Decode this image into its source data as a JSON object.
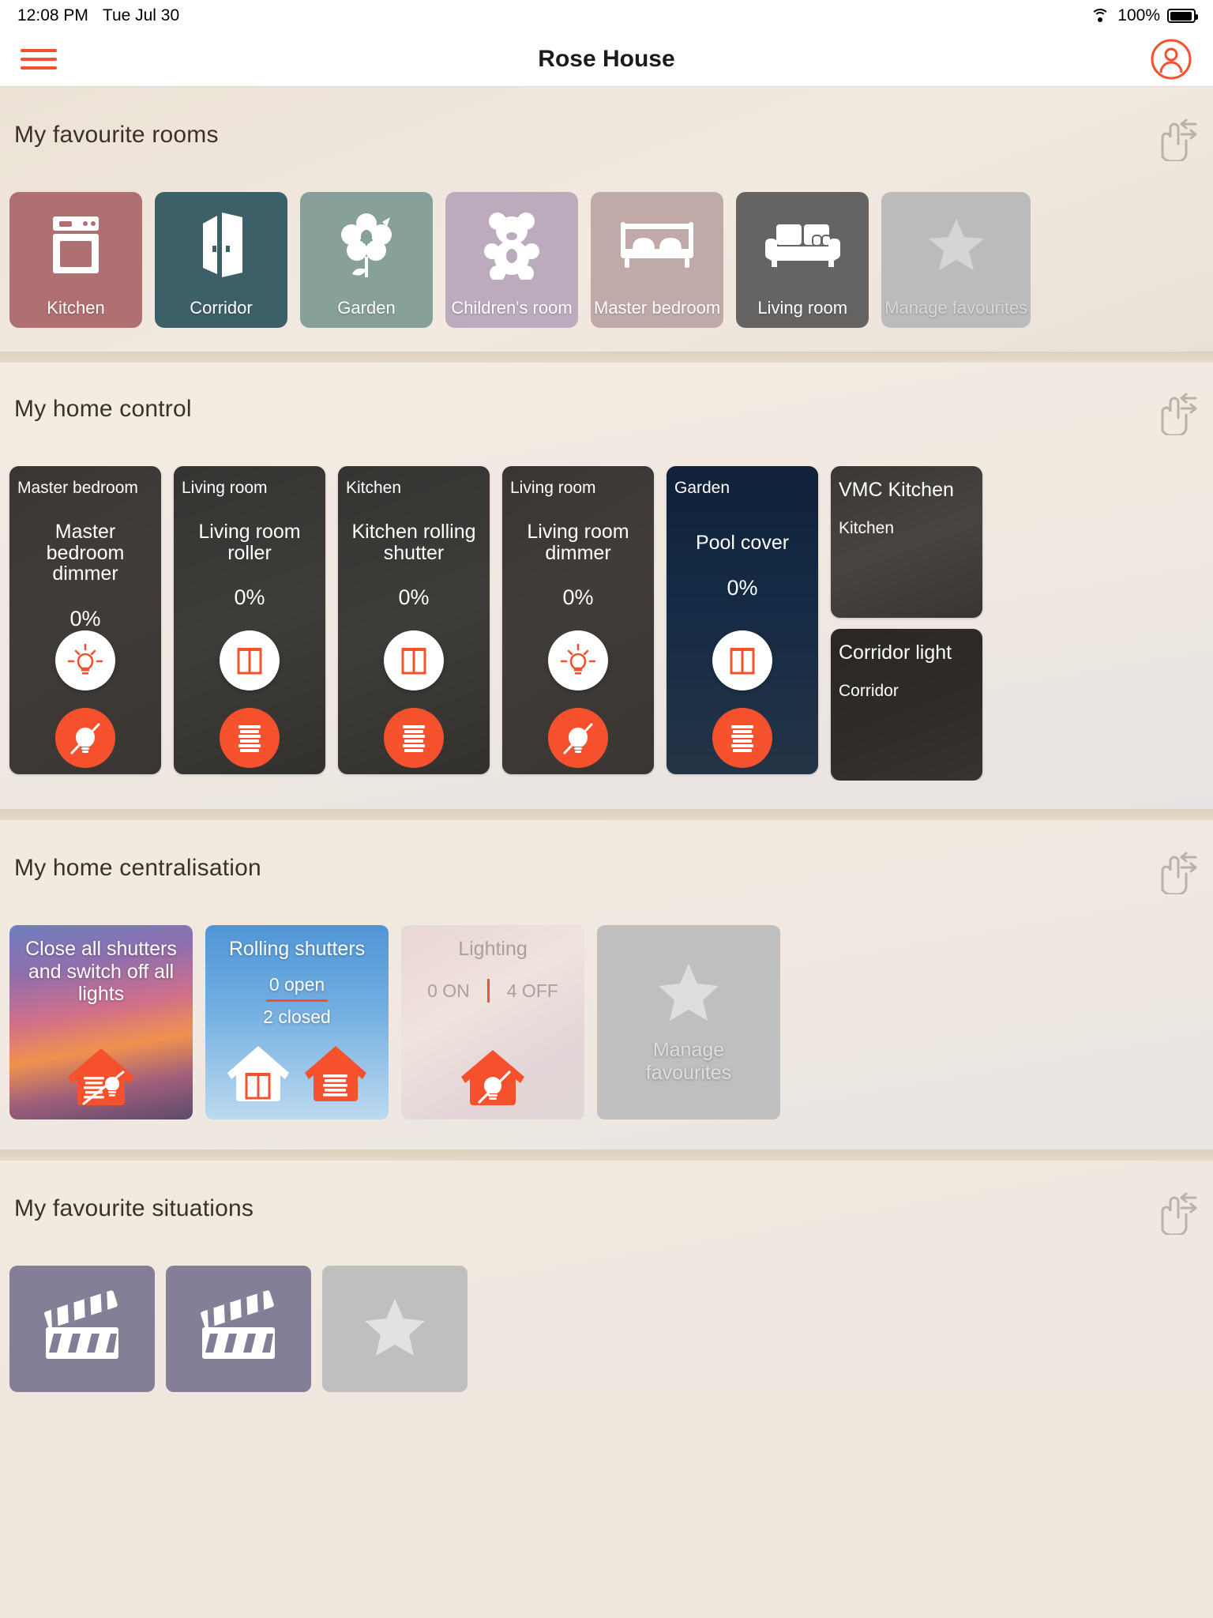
{
  "statusbar": {
    "time": "12:08 PM",
    "date": "Tue Jul 30",
    "battery_percent": "100%",
    "wifi_icon": "wifi-icon",
    "battery_icon": "battery-full-icon"
  },
  "header": {
    "title": "Rose House",
    "menu_icon": "hamburger-menu-icon",
    "account_icon": "account-circle-icon"
  },
  "colors": {
    "accent": "#f4512c",
    "page_background": "#efe7de",
    "section_title": "#3b3129"
  },
  "sections": {
    "rooms": {
      "title": "My favourite rooms",
      "swipe_hint_icon": "swipe-hand-icon",
      "items": [
        {
          "label": "Kitchen",
          "icon": "oven-icon",
          "color": "#b06f70"
        },
        {
          "label": "Corridor",
          "icon": "door-open-icon",
          "color": "#3d5f68"
        },
        {
          "label": "Garden",
          "icon": "flower-icon",
          "color": "#87a09a"
        },
        {
          "label": "Children's room",
          "icon": "teddy-bear-icon",
          "color": "#bbabbd"
        },
        {
          "label": "Master bedroom",
          "icon": "bed-icon",
          "color": "#bfaaa8"
        },
        {
          "label": "Living room",
          "icon": "sofa-icon",
          "color": "#656463"
        },
        {
          "label": "Manage favourites",
          "icon": "star-icon",
          "color": "#bbbbbb"
        }
      ]
    },
    "control": {
      "title": "My home control",
      "swipe_hint_icon": "swipe-hand-icon",
      "items": [
        {
          "room": "Master bedroom",
          "name": "Master bedroom dimmer",
          "value": "0%",
          "primary_icon": "lightbulb-icon",
          "secondary_icon": "lightbulb-off-icon",
          "bg": "grad-bedroom"
        },
        {
          "room": "Living room",
          "name": "Living room roller",
          "value": "0%",
          "primary_icon": "shutter-open-icon",
          "secondary_icon": "shutter-closed-icon",
          "bg": "grad-blinds"
        },
        {
          "room": "Kitchen",
          "name": "Kitchen rolling shutter",
          "value": "0%",
          "primary_icon": "shutter-open-icon",
          "secondary_icon": "shutter-closed-icon",
          "bg": "grad-blinds"
        },
        {
          "room": "Living room",
          "name": "Living room dimmer",
          "value": "0%",
          "primary_icon": "lightbulb-icon",
          "secondary_icon": "lightbulb-off-icon",
          "bg": "grad-bedroom"
        },
        {
          "room": "Garden",
          "name": "Pool cover",
          "value": "0%",
          "primary_icon": "shutter-open-icon",
          "secondary_icon": "shutter-closed-icon",
          "bg": "grad-pool"
        }
      ],
      "partial_items": [
        {
          "title": "VMC Kitchen",
          "subtitle": "Kitchen",
          "bg": "grad-kitchen"
        },
        {
          "title": "Corridor light",
          "subtitle": "Corridor",
          "bg": "grad-corridor"
        }
      ]
    },
    "centralisation": {
      "title": "My home centralisation",
      "swipe_hint_icon": "swipe-hand-icon",
      "items": [
        {
          "title": "Close all shutters and switch off all lights",
          "bg": "grad-sunset",
          "icons": [
            "house-shutter-light-off-icon"
          ]
        },
        {
          "title": "Rolling shutters",
          "bg": "grad-sky",
          "stat_open": "0 open",
          "stat_closed": "2 closed",
          "icons": [
            "house-shutter-open-icon",
            "house-shutter-closed-icon"
          ]
        },
        {
          "title": "Lighting",
          "bg": "grad-blush",
          "stat_on": "0 ON",
          "stat_off": "4 OFF",
          "icons": [
            "house-light-off-icon"
          ]
        },
        {
          "title": "Manage favourites",
          "bg": "manage",
          "icons": [
            "star-icon"
          ]
        }
      ]
    },
    "situations": {
      "title": "My favourite situations",
      "swipe_hint_icon": "swipe-hand-icon",
      "items": [
        {
          "icon": "clapperboard-icon",
          "kind": "scenario"
        },
        {
          "icon": "clapperboard-icon",
          "kind": "scenario"
        },
        {
          "icon": "star-icon",
          "kind": "manage"
        }
      ]
    }
  }
}
